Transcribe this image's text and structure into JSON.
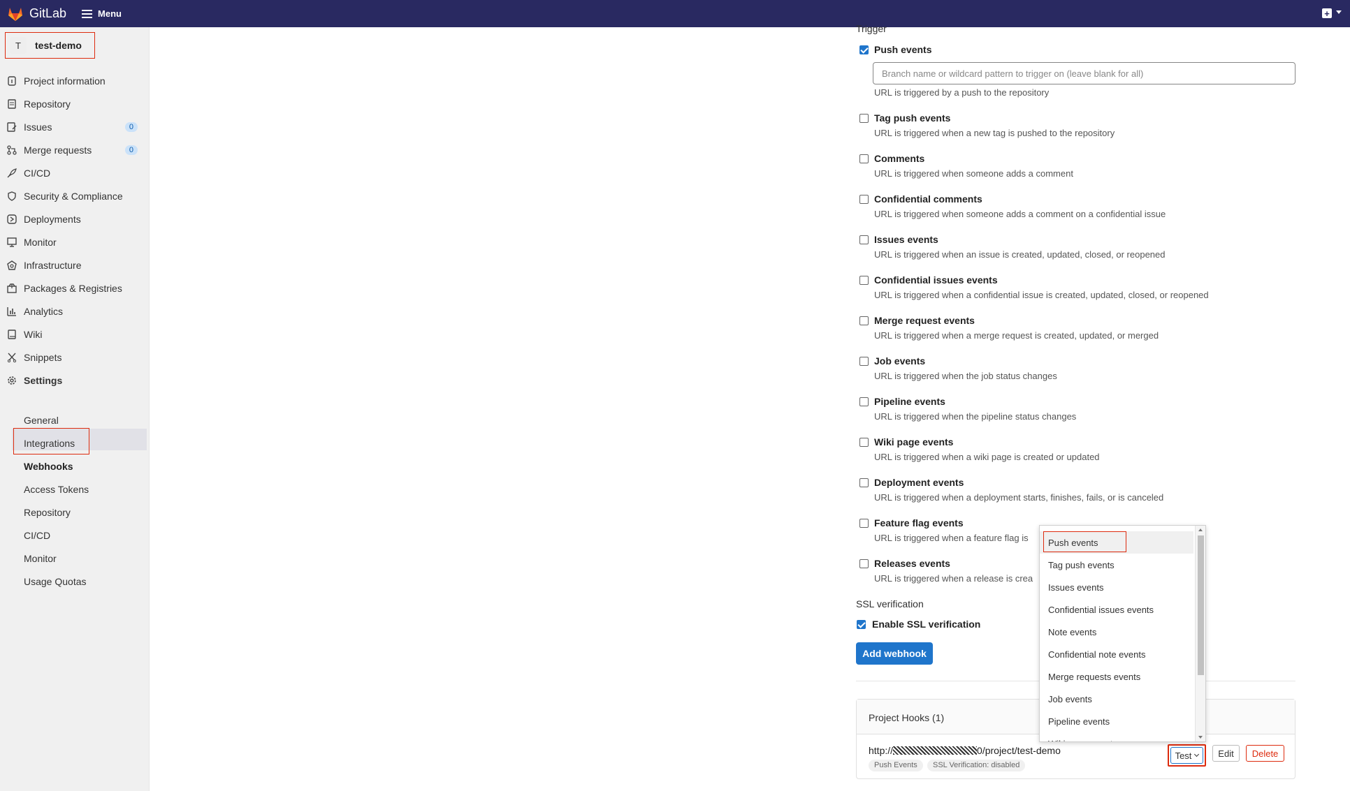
{
  "topbar": {
    "logo_text": "GitLab",
    "menu_label": "Menu",
    "brand_color": "#292961"
  },
  "sidebar": {
    "project_avatar": "T",
    "project_name": "test-demo",
    "items": [
      {
        "label": "Project information",
        "icon": "info-icon"
      },
      {
        "label": "Repository",
        "icon": "doc-icon"
      },
      {
        "label": "Issues",
        "icon": "issues-icon",
        "badge": "0"
      },
      {
        "label": "Merge requests",
        "icon": "merge-icon",
        "badge": "0"
      },
      {
        "label": "CI/CD",
        "icon": "rocket-icon"
      },
      {
        "label": "Security & Compliance",
        "icon": "shield-icon"
      },
      {
        "label": "Deployments",
        "icon": "deploy-icon"
      },
      {
        "label": "Monitor",
        "icon": "monitor-icon"
      },
      {
        "label": "Infrastructure",
        "icon": "cloud-icon"
      },
      {
        "label": "Packages & Registries",
        "icon": "package-icon"
      },
      {
        "label": "Analytics",
        "icon": "chart-icon"
      },
      {
        "label": "Wiki",
        "icon": "book-icon"
      },
      {
        "label": "Snippets",
        "icon": "scissors-icon"
      },
      {
        "label": "Settings",
        "icon": "gear-icon"
      }
    ],
    "settings_sub": [
      "General",
      "Integrations",
      "Webhooks",
      "Access Tokens",
      "Repository",
      "CI/CD",
      "Monitor",
      "Usage Quotas"
    ],
    "active_sub": "Webhooks"
  },
  "form": {
    "trigger_title": "Trigger",
    "branch_placeholder": "Branch name or wildcard pattern to trigger on (leave blank for all)",
    "events": [
      {
        "label": "Push events",
        "desc": "URL is triggered by a push to the repository",
        "checked": true
      },
      {
        "label": "Tag push events",
        "desc": "URL is triggered when a new tag is pushed to the repository",
        "checked": false
      },
      {
        "label": "Comments",
        "desc": "URL is triggered when someone adds a comment",
        "checked": false
      },
      {
        "label": "Confidential comments",
        "desc": "URL is triggered when someone adds a comment on a confidential issue",
        "checked": false
      },
      {
        "label": "Issues events",
        "desc": "URL is triggered when an issue is created, updated, closed, or reopened",
        "checked": false
      },
      {
        "label": "Confidential issues events",
        "desc": "URL is triggered when a confidential issue is created, updated, closed, or reopened",
        "checked": false
      },
      {
        "label": "Merge request events",
        "desc": "URL is triggered when a merge request is created, updated, or merged",
        "checked": false
      },
      {
        "label": "Job events",
        "desc": "URL is triggered when the job status changes",
        "checked": false
      },
      {
        "label": "Pipeline events",
        "desc": "URL is triggered when the pipeline status changes",
        "checked": false
      },
      {
        "label": "Wiki page events",
        "desc": "URL is triggered when a wiki page is created or updated",
        "checked": false
      },
      {
        "label": "Deployment events",
        "desc": "URL is triggered when a deployment starts, finishes, fails, or is canceled",
        "checked": false
      },
      {
        "label": "Feature flag events",
        "desc": "URL is triggered when a feature flag is",
        "checked": false
      },
      {
        "label": "Releases events",
        "desc": "URL is triggered when a release is crea",
        "checked": false
      }
    ],
    "ssl_title": "SSL verification",
    "ssl_label": "Enable SSL verification",
    "ssl_checked": true,
    "add_button": "Add webhook"
  },
  "hooks": {
    "title": "Project Hooks (1)",
    "url_prefix": "http://",
    "url_suffix": "0/project/test-demo",
    "chips": [
      "Push Events",
      "SSL Verification: disabled"
    ],
    "test_label": "Test",
    "edit_label": "Edit",
    "delete_label": "Delete"
  },
  "dropdown": {
    "items": [
      "Push events",
      "Tag push events",
      "Issues events",
      "Confidential issues events",
      "Note events",
      "Confidential note events",
      "Merge requests events",
      "Job events",
      "Pipeline events",
      "Wiki page events"
    ],
    "highlighted": "Push events"
  }
}
